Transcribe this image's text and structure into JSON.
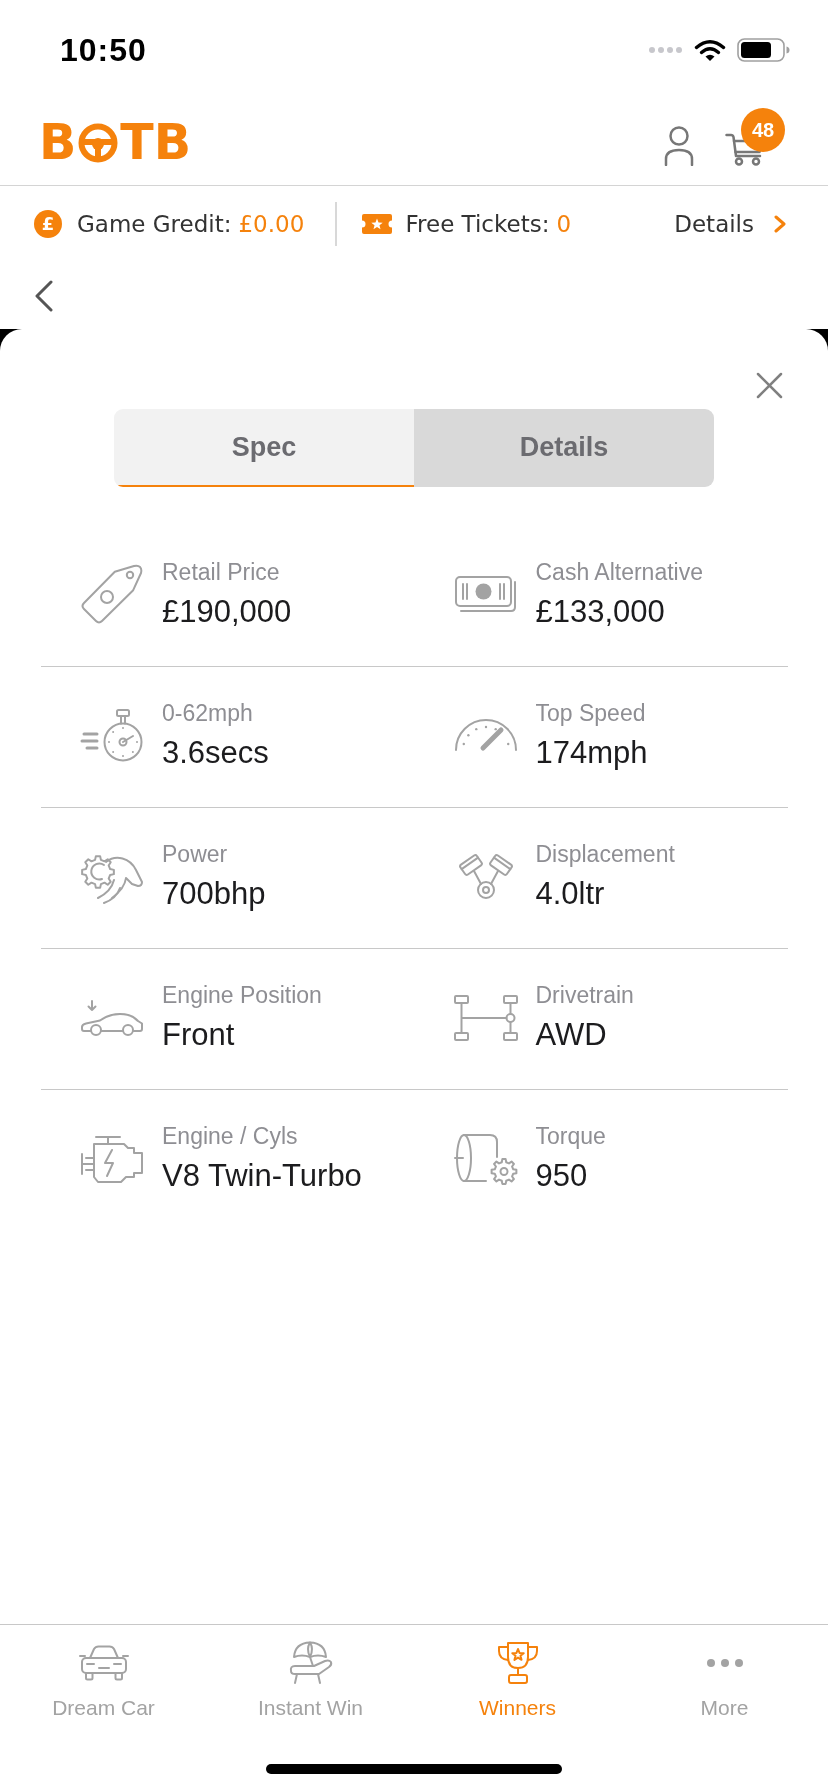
{
  "status_bar": {
    "time": "10:50"
  },
  "header": {
    "logo": {
      "text_before": "B",
      "text_after": "TB"
    },
    "cart_count": "48"
  },
  "credit_bar": {
    "credit_symbol": "£",
    "game_credit_label": "Game Gredit:",
    "game_credit_value": "£0.00",
    "free_tickets_label": "Free Tickets:",
    "free_tickets_value": "0",
    "details_link": "Details"
  },
  "spec_sheet": {
    "tabs": [
      {
        "label": "Spec",
        "selected": true
      },
      {
        "label": "Details",
        "selected": false
      }
    ],
    "specs": [
      {
        "kind": "price",
        "label": "Retail Price",
        "value": "£190,000"
      },
      {
        "kind": "cash",
        "label": "Cash Alternative",
        "value": "£133,000"
      },
      {
        "kind": "acceleration",
        "label": "0-62mph",
        "value": "3.6secs"
      },
      {
        "kind": "speed",
        "label": "Top Speed",
        "value": "174mph"
      },
      {
        "kind": "power",
        "label": "Power",
        "value": "700bhp"
      },
      {
        "kind": "displacement",
        "label": "Displacement",
        "value": "4.0ltr"
      },
      {
        "kind": "engine_position",
        "label": "Engine Position",
        "value": "Front"
      },
      {
        "kind": "drivetrain",
        "label": "Drivetrain",
        "value": "AWD"
      },
      {
        "kind": "engine",
        "label": "Engine / Cyls",
        "value": "V8 Twin-Turbo"
      },
      {
        "kind": "torque",
        "label": "Torque",
        "value": "950"
      }
    ]
  },
  "tab_bar": [
    {
      "kind": "car",
      "label": "Dream Car",
      "selected": false
    },
    {
      "kind": "beach",
      "label": "Instant Win",
      "selected": false
    },
    {
      "kind": "trophy",
      "label": "Winners",
      "selected": true
    },
    {
      "kind": "more",
      "label": "More",
      "selected": false
    }
  ]
}
